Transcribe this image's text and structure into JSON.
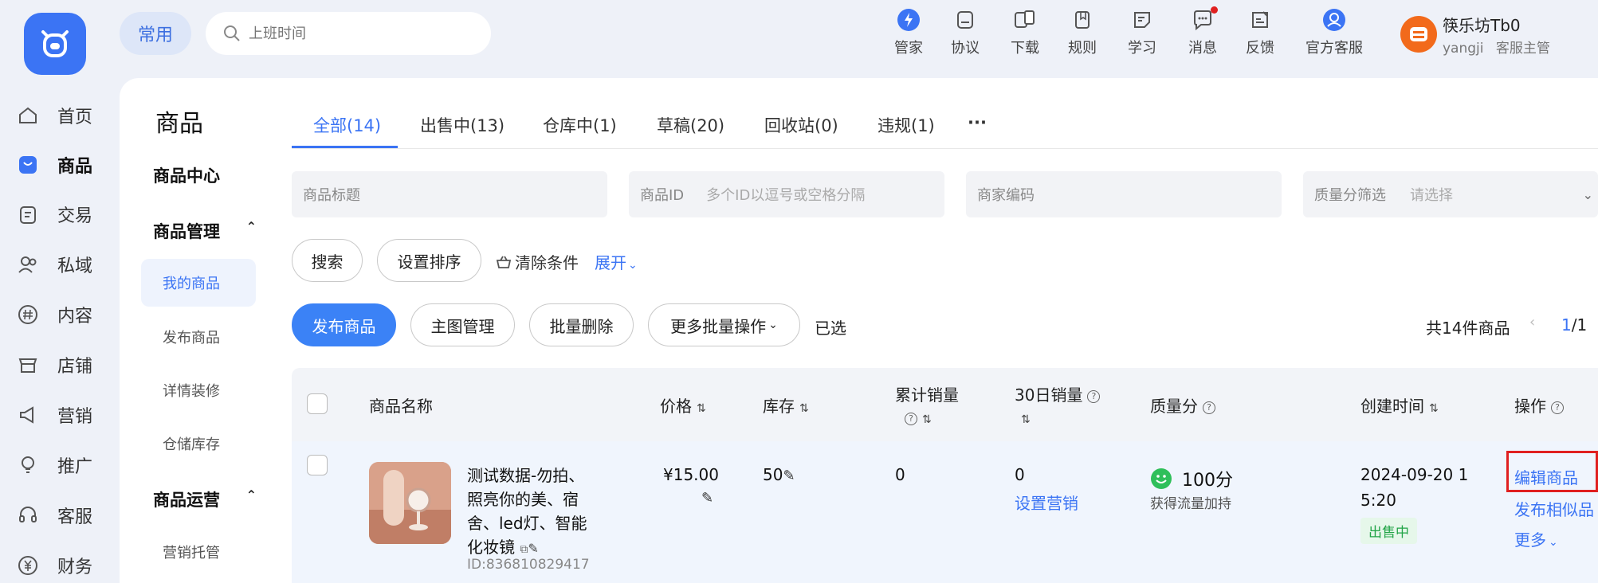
{
  "header": {
    "common_label": "常用",
    "search_placeholder": "上班时间",
    "tools": [
      {
        "label": "管家",
        "icon": "lightning-icon"
      },
      {
        "label": "协议",
        "icon": "document-icon"
      },
      {
        "label": "下载",
        "icon": "devices-icon"
      },
      {
        "label": "规则",
        "icon": "book-icon"
      },
      {
        "label": "学习",
        "icon": "note-icon"
      },
      {
        "label": "消息",
        "icon": "chat-icon"
      },
      {
        "label": "反馈",
        "icon": "feedback-icon"
      },
      {
        "label": "官方客服",
        "icon": "support-icon"
      }
    ],
    "user": {
      "name": "筷乐坊Tb0",
      "account": "yangji",
      "role": "客服主管"
    }
  },
  "rail": {
    "items": [
      {
        "label": "首页",
        "icon": "home-icon"
      },
      {
        "label": "商品",
        "icon": "bag-icon"
      },
      {
        "label": "交易",
        "icon": "clipboard-icon"
      },
      {
        "label": "私域",
        "icon": "users-icon"
      },
      {
        "label": "内容",
        "icon": "hashtag-icon"
      },
      {
        "label": "店铺",
        "icon": "store-icon"
      },
      {
        "label": "营销",
        "icon": "megaphone-icon"
      },
      {
        "label": "推广",
        "icon": "bulb-icon"
      },
      {
        "label": "客服",
        "icon": "headset-icon"
      },
      {
        "label": "财务",
        "icon": "yen-icon"
      }
    ]
  },
  "page": {
    "title": "商品"
  },
  "subnav": {
    "center": "商品中心",
    "management": "商品管理",
    "my_products": "我的商品",
    "publish": "发布商品",
    "detail_decor": "详情装修",
    "warehouse": "仓储库存",
    "operations": "商品运营",
    "marketing_host": "营销托管"
  },
  "tabs": [
    "全部(14)",
    "出售中(13)",
    "仓库中(1)",
    "草稿(20)",
    "回收站(0)",
    "违规(1)",
    "···"
  ],
  "filters": {
    "title_placeholder": "商品标题",
    "id_label": "商品ID",
    "id_placeholder": "多个ID以逗号或空格分隔",
    "code_placeholder": "商家编码",
    "quality_label": "质量分筛选",
    "quality_placeholder": "请选择"
  },
  "actions": {
    "search": "搜索",
    "sort": "设置排序",
    "clear": "清除条件",
    "expand": "展开",
    "publish": "发布商品",
    "main_image": "主图管理",
    "batch_delete": "批量删除",
    "more_batch": "更多批量操作",
    "selected": "已选",
    "total": "共14件商品",
    "page_current": "1",
    "page_total": "/1"
  },
  "table": {
    "headers": {
      "name": "商品名称",
      "price": "价格",
      "stock": "库存",
      "total_sales": "累计销量",
      "sales30": "30日销量",
      "quality": "质量分",
      "created": "创建时间",
      "ops": "操作"
    },
    "row": {
      "title": "测试数据-勿拍、照亮你的美、宿舍、led灯、智能化妆镜",
      "id": "ID:836810829417",
      "price": "¥15.00",
      "stock": "50",
      "total_sales": "0",
      "sales30": "0",
      "set_marketing": "设置营销",
      "quality_score": "100分",
      "quality_note": "获得流量加持",
      "created_line1": "2024-09-20 1",
      "created_line2": "5:20",
      "status": "出售中",
      "edit": "编辑商品",
      "publish_similar": "发布相似品",
      "more": "更多"
    }
  }
}
